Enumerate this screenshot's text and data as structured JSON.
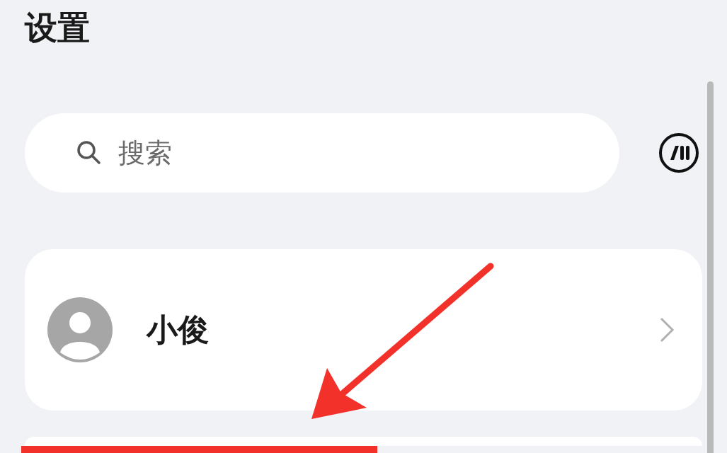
{
  "title": "设置",
  "search": {
    "placeholder": "搜索"
  },
  "profile": {
    "name": "小俊"
  }
}
